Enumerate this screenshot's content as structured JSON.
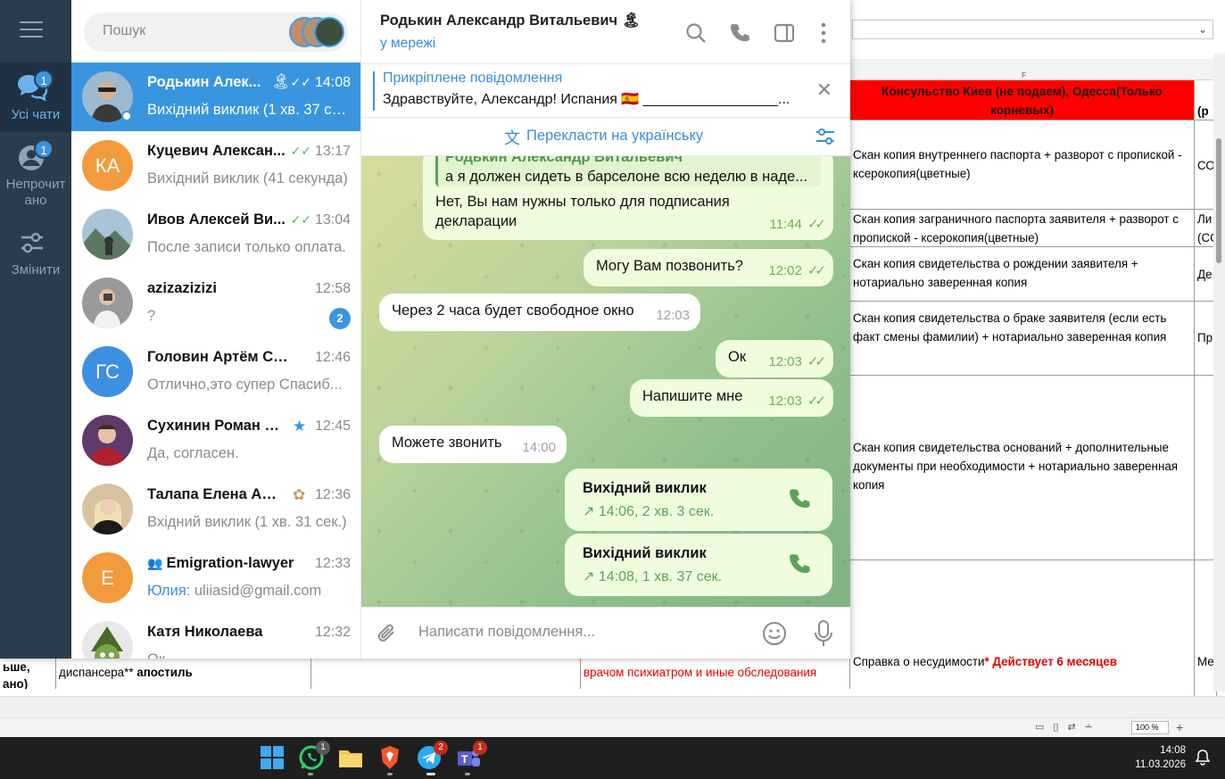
{
  "telegram": {
    "search_placeholder": "Пошук",
    "rail": {
      "all_chats": {
        "label": "Усі чати",
        "badge": "1"
      },
      "unread": {
        "label1": "Непрочит",
        "label2": "ано",
        "badge": "1"
      },
      "edit": {
        "label": "Змінити"
      }
    },
    "chats": [
      {
        "name": "Родькин Алек...",
        "badge_icon": "🏝",
        "time": "14:08",
        "preview": "Вихідний виклик (1 хв. 37 се...",
        "checks": true,
        "avatar_text": "",
        "avatar_color": "#6f8fa8",
        "active": true
      },
      {
        "name": "Куцевич Алексан...",
        "time": "13:17",
        "preview": "Вихідний виклик (41 секунда)",
        "checks": true,
        "avatar_text": "КА",
        "avatar_color": "#f39a3c"
      },
      {
        "name": "Ивов Алексей Ви...",
        "time": "13:04",
        "preview": "После записи только оплата.",
        "checks": true,
        "avatar_text": "",
        "avatar_color": "#7b8f86"
      },
      {
        "name": "azizazizizi",
        "time": "12:58",
        "preview": "?",
        "unread": "2",
        "avatar_text": "",
        "avatar_color": "#8c8c8c"
      },
      {
        "name": "Головин Артём Серг...",
        "time": "12:46",
        "preview": "Отлично,это супер  Спасиб...",
        "avatar_text": "ГС",
        "avatar_color": "#3d8fe0"
      },
      {
        "name": "Сухинин Роман А...",
        "badge_icon": "★",
        "time": "12:45",
        "preview": "Да, согласен.",
        "avatar_text": "",
        "avatar_color": "#6d3f73"
      },
      {
        "name": "Талапа Елена Але...",
        "badge_icon": "✿",
        "time": "12:36",
        "preview": "Вхідний виклик (1 хв. 31 сек.)",
        "avatar_text": "",
        "avatar_color": "#c9a77f"
      },
      {
        "name": "Emigration-lawyer",
        "group_icon": "👥",
        "time": "12:33",
        "preview_who": "Юлия:",
        "preview": " uliiasid@gmail.com",
        "avatar_text": "E",
        "avatar_color": "#f39a3c"
      },
      {
        "name": "Катя Николаева",
        "time": "12:32",
        "preview": "Ок...",
        "avatar_text": "",
        "avatar_color": "#5d7a3a"
      }
    ],
    "header": {
      "title": "Родькин Александр Витальевич 🏝",
      "status": "у мережі"
    },
    "pinned": {
      "label": "Прикріплене повідомлення",
      "text": "Здравствуйте, Александр! Испания 🇪🇸 _________________..."
    },
    "translate": {
      "label": "Перекласти на українську"
    },
    "messages": {
      "m1_quote_name": "Родькин Александр Витальевич",
      "m1_quote_text": "а я должен сидеть в барселоне всю неделю в наде...",
      "m1_text1": "Нет, Вы нам нужны только для подписания",
      "m1_text2": "декларации",
      "m1_time": "11:44",
      "m2_text": "Могу Вам позвонить?",
      "m2_time": "12:02",
      "m3_text": "Через 2 часа будет свободное окно",
      "m3_time": "12:03",
      "m4_text": "Ок",
      "m4_time": "12:03",
      "m5_text": "Напишите мне",
      "m5_time": "12:03",
      "m6_text": "Можете звонить",
      "m6_time": "14:00",
      "call1_title": "Вихідний виклик",
      "call1_info": "14:06, 2 хв. 3 сек.",
      "call2_title": "Вихідний виклик",
      "call2_info": "14:08, 1 хв. 37 сек."
    },
    "input_placeholder": "Написати повідомлення..."
  },
  "spreadsheet": {
    "col_letter": "F",
    "header_cell": "Консульство Киев (не подаем), Одесса(Только корневых)",
    "header_cell_right": "(р",
    "rows": [
      {
        "text": "Скан копия внутреннего паспорта + разворот с пропиской - ксерокопия(цветные)",
        "right": "СО"
      },
      {
        "text": "Скан копия заграничного паспорта заявителя + разворот с пропиской - ксерокопия(цветные)",
        "right": "Ли (СС"
      },
      {
        "text": "Скан копия свидетельства о рождении заявителя + нотариально заверенная копия",
        "right": "Де"
      },
      {
        "text": "Скан копия свидетельства о браке заявителя (если есть факт смены фамилии) + нотариально заверенная копия",
        "right": "Пр"
      },
      {
        "text": "Скан копия свидетельства оснований + дополнительные документы при необходимости + нотариально заверенная копия",
        "right": ""
      },
      {
        "text": "Справка о несудимости",
        "text_red": "* Действует 6 месяцев",
        "right": "Ме"
      }
    ],
    "under_left1": "ьше,",
    "under_left2": "ано)",
    "under_mid": "диспансера** ",
    "under_mid_bold": "апостиль",
    "under_red": "врачом психиатром и иные обследования",
    "zoom": "100 %"
  },
  "taskbar": {
    "time": "14:08",
    "date": "11.03.2026",
    "whatsapp_badge": "1",
    "telegram_badge": "2",
    "teams_badge": "1"
  }
}
